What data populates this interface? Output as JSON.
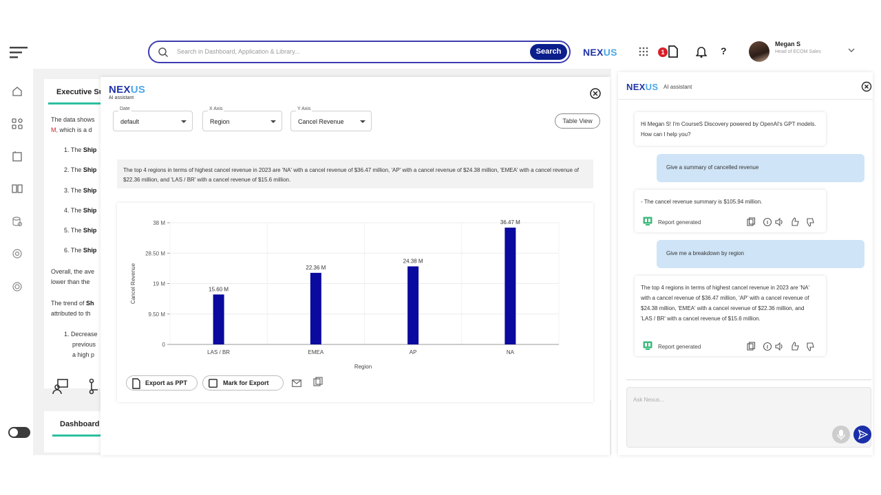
{
  "header": {
    "search_placeholder": "Search in Dashboard, Application & Library...",
    "search_button": "Search",
    "brand_prefix": "NEX",
    "brand_suffix": "US",
    "notification_count": "1",
    "help": "?",
    "user_name": "Megan S",
    "user_role": "Head of ECOM Sales"
  },
  "background": {
    "exec_tab": "Executive Su",
    "exec_lines": [
      {
        "pre": "The data shows",
        "bold": "",
        "post": ""
      },
      {
        "pre": "",
        "red": "M,",
        "post": " which is a d"
      }
    ],
    "items": [
      "1. The ",
      "2. The ",
      "3. The ",
      "4. The ",
      "5. The ",
      "6. The "
    ],
    "item_bold": "Ship",
    "para2": [
      "Overall, the ave",
      "lower than the"
    ],
    "para3_pre": "The trend of ",
    "para3_bold": "Sh",
    "para3_line2": "attributed to th",
    "sub_items": [
      "1. Decrease",
      "previous",
      "a high p"
    ],
    "dash_tab": "Dashboard"
  },
  "modal": {
    "brand_prefix": "NEX",
    "brand_suffix": "US",
    "subtitle": "AI assistant",
    "date_label": "Date",
    "date_value": "default",
    "xaxis_label": "X Axis",
    "xaxis_value": "Region",
    "yaxis_label": "Y Axis",
    "yaxis_value": "Cancel Revenue",
    "table_view": "Table View",
    "summary": "The top 4 regions in terms of highest cancel revenue in 2023 are 'NA' with a cancel revenue of $36.47 million, 'AP' with a cancel revenue of $24.38 million, 'EMEA' with a cancel revenue of $22.36 million, and 'LAS / BR' with a cancel revenue of $15.6 million.",
    "export_ppt": "Export as PPT",
    "mark_export": "Mark for Export"
  },
  "chart_data": {
    "type": "bar",
    "categories": [
      "LAS / BR",
      "EMEA",
      "AP",
      "NA"
    ],
    "values": [
      15.6,
      22.36,
      24.38,
      36.47
    ],
    "data_labels": [
      "15.60 M",
      "22.36 M",
      "24.38 M",
      "36.47 M"
    ],
    "yticks": [
      "0",
      "9.50 M",
      "19 M",
      "28.50 M",
      "38 M"
    ],
    "ytick_values": [
      0,
      9.5,
      19,
      28.5,
      38
    ],
    "ylim": [
      0,
      38
    ],
    "xlabel": "Region",
    "ylabel": "Cancel Revenue",
    "bar_color": "#0a0a9e"
  },
  "assistant": {
    "brand_prefix": "NEX",
    "brand_suffix": "US",
    "subtitle": "AI assistant",
    "greeting": "Hi Megan S! I'm CourseS Discovery powered by OpenAI's GPT models. How can I help you?",
    "user_q1": "Give a summary of cancelled revenue",
    "bot_a1": "- The cancel revenue summary is $105.94 million.",
    "report_generated": "Report generated",
    "user_q2": "Give me a breakdown by region",
    "bot_a2": "The top 4 regions in terms of highest cancel revenue in 2023 are 'NA' with a cancel revenue of $36.47 million, 'AP' with a cancel revenue of $24.38 million, 'EMEA' with a cancel revenue of $22.36 million, and 'LAS / BR' with a cancel revenue of $15.6 million.",
    "ask_placeholder": "Ask Nexus..."
  }
}
